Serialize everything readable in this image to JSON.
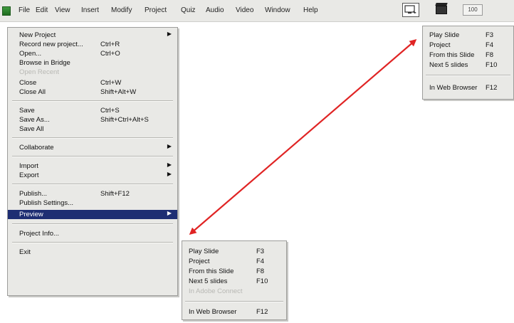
{
  "menubar": {
    "items": [
      "File",
      "Edit",
      "View",
      "Insert",
      "Modify",
      "Project",
      "Quiz",
      "Audio",
      "Video",
      "Window",
      "Help"
    ],
    "bubble_label": "100"
  },
  "file_menu": {
    "items": [
      {
        "label": "New Project",
        "shortcut": "",
        "submenu": true,
        "disabled": false
      },
      {
        "label": "Record new project...",
        "shortcut": "Ctrl+R",
        "submenu": false,
        "disabled": false
      },
      {
        "label": "Open...",
        "shortcut": "Ctrl+O",
        "submenu": false,
        "disabled": false
      },
      {
        "label": "Browse in Bridge",
        "shortcut": "",
        "submenu": false,
        "disabled": false
      },
      {
        "label": "Open Recent",
        "shortcut": "",
        "submenu": false,
        "disabled": true
      },
      {
        "label": "Close",
        "shortcut": "Ctrl+W",
        "submenu": false,
        "disabled": false
      },
      {
        "label": "Close All",
        "shortcut": "Shift+Alt+W",
        "submenu": false,
        "disabled": false
      },
      {
        "label": "Save",
        "shortcut": "Ctrl+S",
        "submenu": false,
        "disabled": false
      },
      {
        "label": "Save As...",
        "shortcut": "Shift+Ctrl+Alt+S",
        "submenu": false,
        "disabled": false
      },
      {
        "label": "Save All",
        "shortcut": "",
        "submenu": false,
        "disabled": false
      },
      {
        "label": "Collaborate",
        "shortcut": "",
        "submenu": true,
        "disabled": false
      },
      {
        "label": "Import",
        "shortcut": "",
        "submenu": true,
        "disabled": false
      },
      {
        "label": "Export",
        "shortcut": "",
        "submenu": true,
        "disabled": false
      },
      {
        "label": "Publish...",
        "shortcut": "Shift+F12",
        "submenu": false,
        "disabled": false
      },
      {
        "label": "Publish Settings...",
        "shortcut": "",
        "submenu": false,
        "disabled": false
      },
      {
        "label": "Preview",
        "shortcut": "",
        "submenu": true,
        "disabled": false,
        "highlighted": true
      },
      {
        "label": "Project Info...",
        "shortcut": "",
        "submenu": false,
        "disabled": false
      },
      {
        "label": "Exit",
        "shortcut": "",
        "submenu": false,
        "disabled": false
      }
    ]
  },
  "preview_menu": {
    "items": [
      {
        "label": "Play Slide",
        "shortcut": "F3",
        "disabled": false
      },
      {
        "label": "Project",
        "shortcut": "F4",
        "disabled": false
      },
      {
        "label": "From this Slide",
        "shortcut": "F8",
        "disabled": false
      },
      {
        "label": "Next 5 slides",
        "shortcut": "F10",
        "disabled": false
      },
      {
        "label": "In Adobe Connect",
        "shortcut": "",
        "disabled": true
      },
      {
        "label": "In Web Browser",
        "shortcut": "F12",
        "disabled": false
      }
    ]
  },
  "toolbar_preview_menu": {
    "items": [
      {
        "label": "Play Slide",
        "shortcut": "F3"
      },
      {
        "label": "Project",
        "shortcut": "F4"
      },
      {
        "label": "From this Slide",
        "shortcut": "F8"
      },
      {
        "label": "Next 5 slides",
        "shortcut": "F10"
      },
      {
        "label": "In Web Browser",
        "shortcut": "F12"
      }
    ]
  },
  "colors": {
    "menu_bg": "#e9e9e6",
    "highlight": "#1e2e73",
    "arrow": "#e02424"
  }
}
